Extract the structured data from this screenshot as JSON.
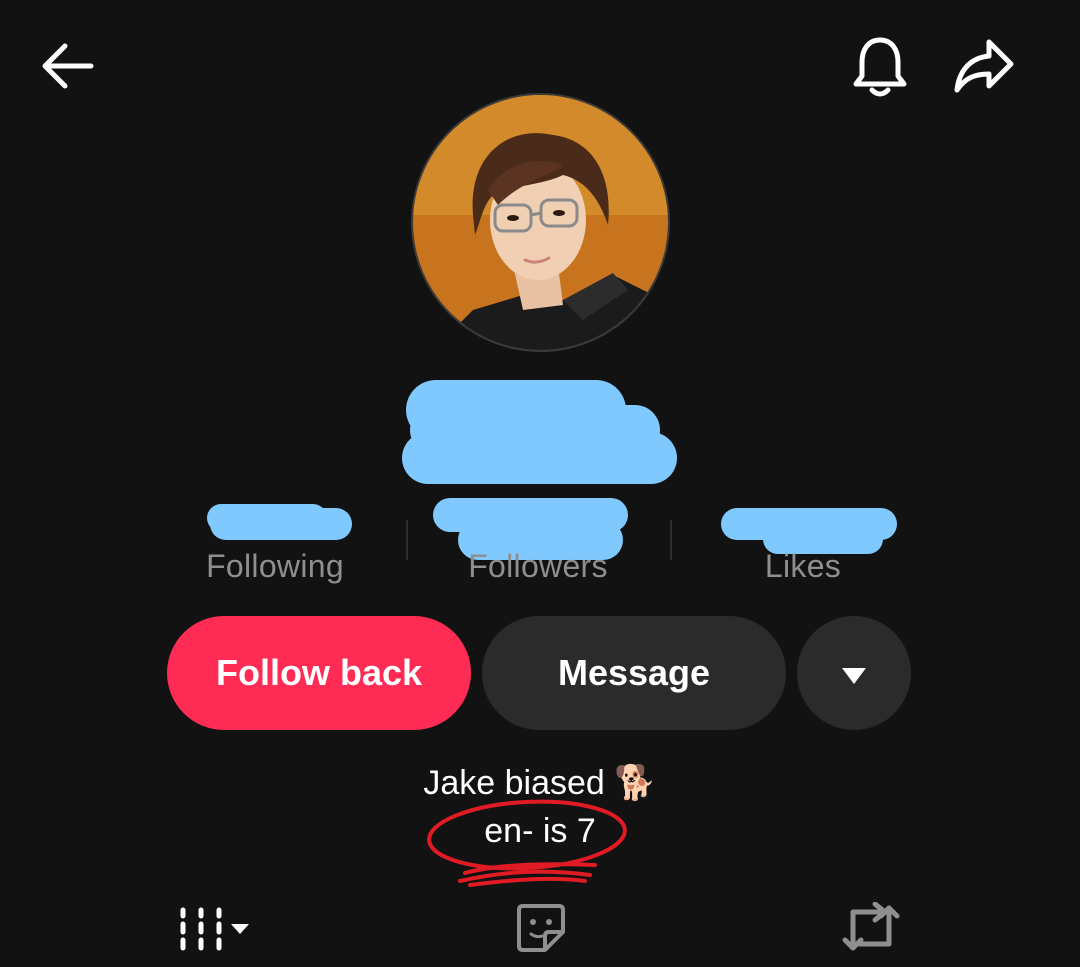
{
  "header": {
    "back_icon": "arrow-left-icon",
    "notify_icon": "bell-icon",
    "share_icon": "share-arrow-icon"
  },
  "profile": {
    "avatar_icon": "profile-avatar",
    "name_redacted": true
  },
  "stats": [
    {
      "label": "Following"
    },
    {
      "label": "Followers"
    },
    {
      "label": "Likes"
    }
  ],
  "actions": {
    "follow_back_label": "Follow back",
    "message_label": "Message",
    "more_icon": "caret-down-icon"
  },
  "bio": {
    "line1": "Jake biased 🐕",
    "line2": "en- is 7"
  },
  "tabs": [
    {
      "icon": "videos-grid-icon"
    },
    {
      "icon": "favorites-sticker-icon"
    },
    {
      "icon": "reposts-icon"
    }
  ],
  "colors": {
    "background": "#121212",
    "accent": "#fe2c55",
    "button_secondary": "#2b2b2b",
    "redaction": "#7fc9ff",
    "annotation": "#e01b24"
  }
}
